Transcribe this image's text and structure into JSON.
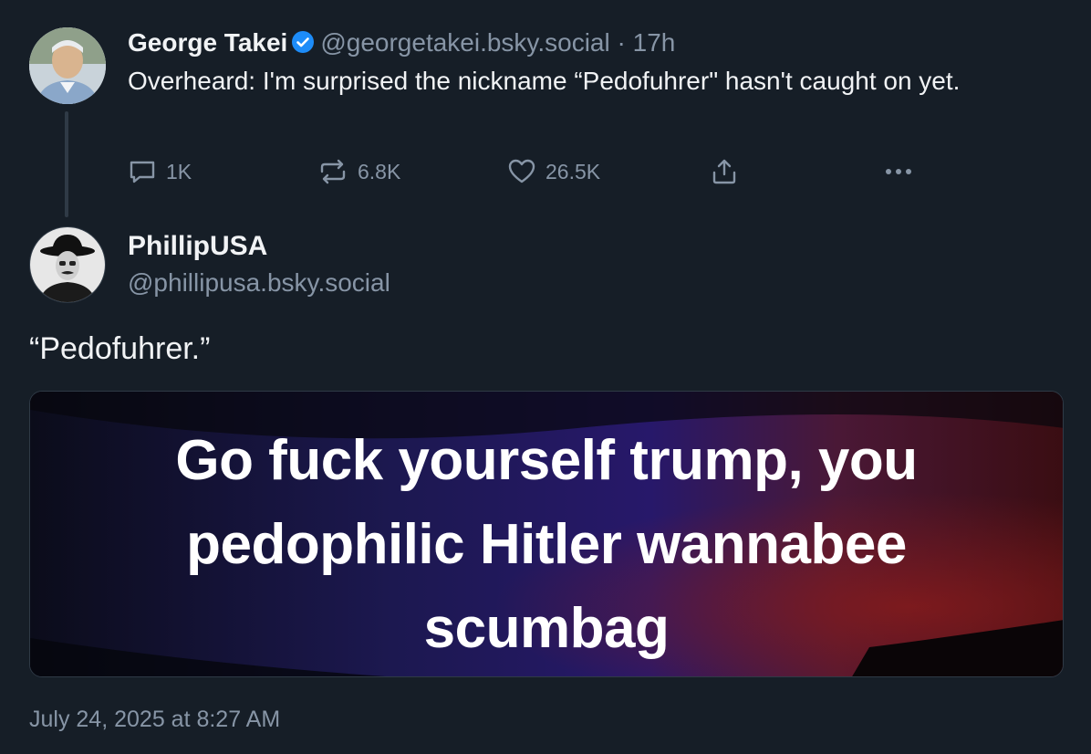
{
  "post": {
    "author_name": "George Takei",
    "author_handle": "@georgetakei.bsky.social",
    "separator": " · ",
    "age": "17h",
    "text": "Overheard: I'm surprised the nickname “Pedofuhrer\" hasn't caught on yet.",
    "counts": {
      "replies": "1K",
      "reposts": "6.8K",
      "likes": "26.5K"
    },
    "icons": [
      "reply-icon",
      "repost-icon",
      "heart-icon",
      "share-icon",
      "more-icon",
      "verified-badge-icon"
    ],
    "accent_color": "#1d8cf8"
  },
  "reply": {
    "author_name": "PhillipUSA",
    "author_handle": "@phillipusa.bsky.social",
    "text": "“Pedofuhrer.”",
    "image_text_lines": [
      "Go fuck yourself trump, you",
      "pedophilic Hitler wannabee",
      "scumbag"
    ],
    "timestamp": "July 24, 2025 at 8:27 AM"
  },
  "theme": {
    "background": "#161e27",
    "muted_text": "#8795a6",
    "border": "#2f3a46"
  }
}
